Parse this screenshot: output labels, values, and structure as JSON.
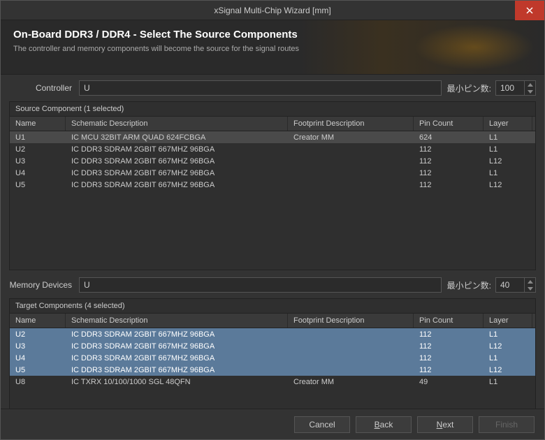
{
  "titlebar": {
    "title": "xSignal Multi-Chip Wizard [mm]"
  },
  "header": {
    "title": "On-Board DDR3 / DDR4 - Select The Source Components",
    "subtitle": "The controller and memory components will become the source for the signal routes"
  },
  "form": {
    "controller_label": "Controller",
    "controller_value": "U",
    "memory_label": "Memory Devices",
    "memory_value": "U",
    "min_pins_label": "最小ピン数:",
    "min_pins_source": "100",
    "min_pins_target": "40"
  },
  "columns": {
    "name": "Name",
    "schematic": "Schematic Description",
    "footprint": "Footprint Description",
    "pin_count": "Pin Count",
    "layer": "Layer"
  },
  "source": {
    "header": "Source Component (1 selected)",
    "rows": [
      {
        "name": "U1",
        "schem": "IC MCU 32BIT ARM QUAD 624FCBGA",
        "foot": "Creator MM",
        "pin": "624",
        "layer": "L1",
        "selected": true
      },
      {
        "name": "U2",
        "schem": "IC DDR3 SDRAM 2GBIT 667MHZ 96BGA",
        "foot": "",
        "pin": "112",
        "layer": "L1",
        "selected": false
      },
      {
        "name": "U3",
        "schem": "IC DDR3 SDRAM 2GBIT 667MHZ 96BGA",
        "foot": "",
        "pin": "112",
        "layer": "L12",
        "selected": false
      },
      {
        "name": "U4",
        "schem": "IC DDR3 SDRAM 2GBIT 667MHZ 96BGA",
        "foot": "",
        "pin": "112",
        "layer": "L1",
        "selected": false
      },
      {
        "name": "U5",
        "schem": "IC DDR3 SDRAM 2GBIT 667MHZ 96BGA",
        "foot": "",
        "pin": "112",
        "layer": "L12",
        "selected": false
      }
    ]
  },
  "target": {
    "header": "Target Components (4 selected)",
    "rows": [
      {
        "name": "U2",
        "schem": "IC DDR3 SDRAM 2GBIT 667MHZ 96BGA",
        "foot": "",
        "pin": "112",
        "layer": "L1",
        "selected": true
      },
      {
        "name": "U3",
        "schem": "IC DDR3 SDRAM 2GBIT 667MHZ 96BGA",
        "foot": "",
        "pin": "112",
        "layer": "L12",
        "selected": true
      },
      {
        "name": "U4",
        "schem": "IC DDR3 SDRAM 2GBIT 667MHZ 96BGA",
        "foot": "",
        "pin": "112",
        "layer": "L1",
        "selected": true
      },
      {
        "name": "U5",
        "schem": "IC DDR3 SDRAM 2GBIT 667MHZ 96BGA",
        "foot": "",
        "pin": "112",
        "layer": "L12",
        "selected": true
      },
      {
        "name": "U8",
        "schem": "IC TXRX 10/100/1000 SGL 48QFN",
        "foot": "Creator MM",
        "pin": "49",
        "layer": "L1",
        "selected": false
      }
    ]
  },
  "buttons": {
    "cancel": "Cancel",
    "back_prefix": "B",
    "back_rest": "ack",
    "next_prefix": "N",
    "next_rest": "ext",
    "finish": "Finish"
  }
}
